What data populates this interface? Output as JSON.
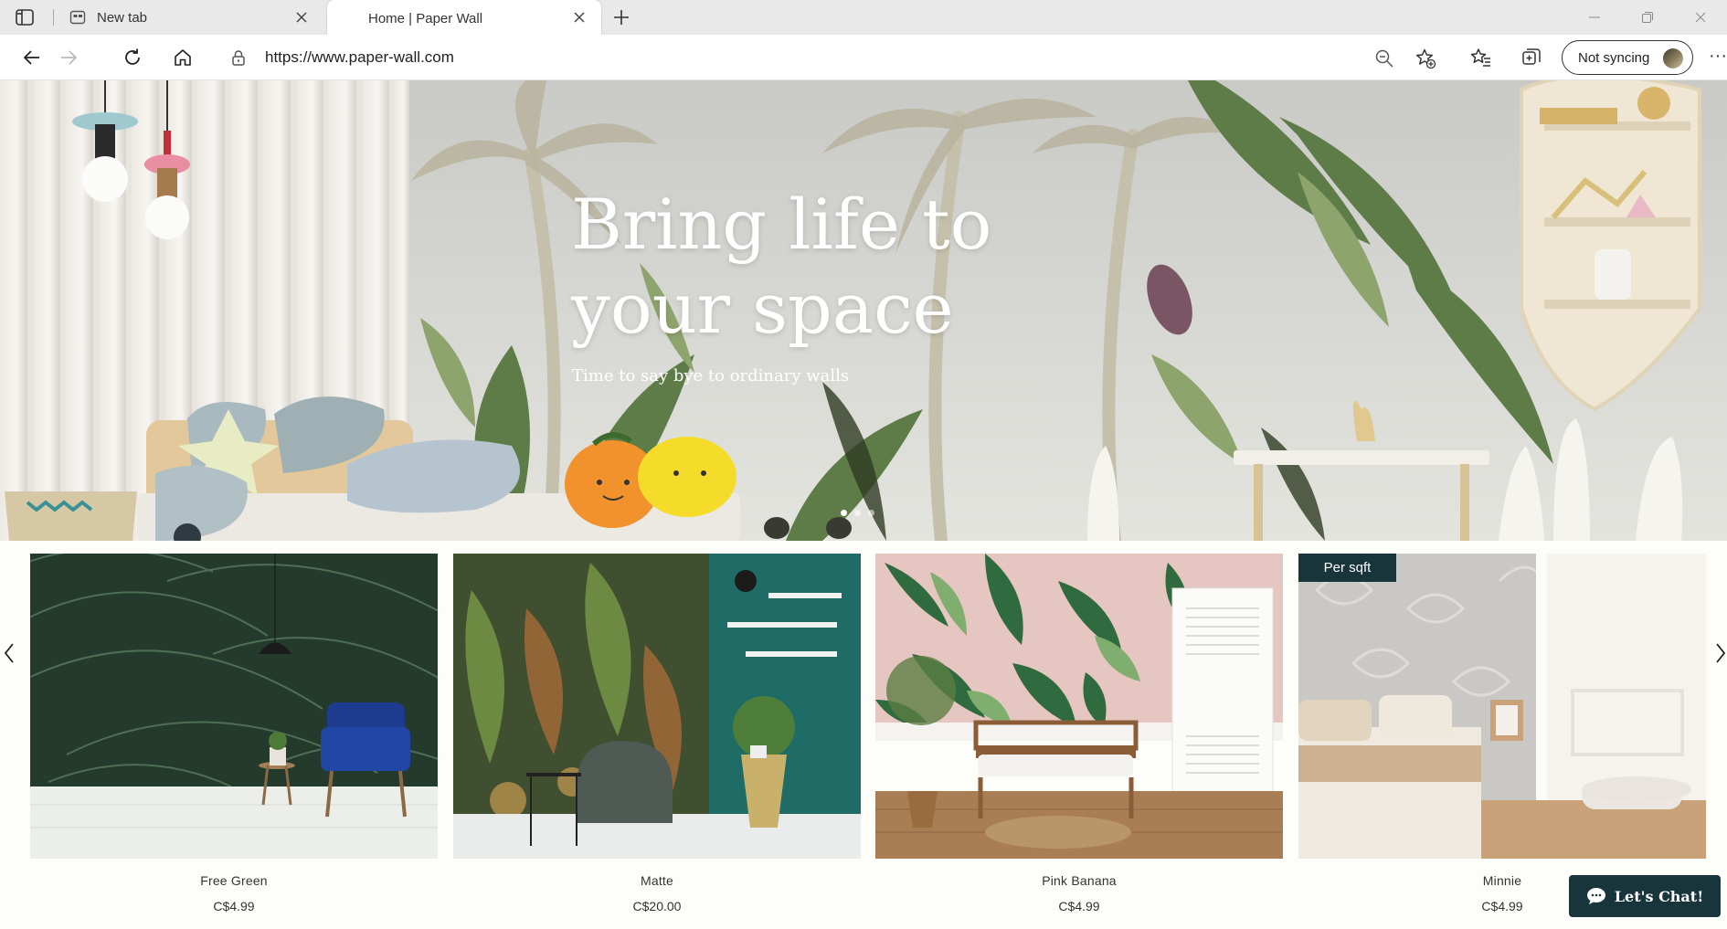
{
  "browser": {
    "tabs": [
      {
        "title": "New tab",
        "active": false
      },
      {
        "title": "Home | Paper Wall",
        "active": true
      }
    ],
    "url": "https://www.paper-wall.com",
    "sync_label": "Not syncing",
    "more_label": "···"
  },
  "hero": {
    "title": "Bring life to your space",
    "subtitle": "Time to say bye to ordinary walls",
    "slides_total": 3,
    "active_slide": 1
  },
  "products": [
    {
      "name": "Free Green",
      "price": "C$4.99",
      "badge": ""
    },
    {
      "name": "Matte",
      "price": "C$20.00",
      "badge": ""
    },
    {
      "name": "Pink Banana",
      "price": "C$4.99",
      "badge": ""
    },
    {
      "name": "Minnie",
      "price": "C$4.99",
      "badge": "Per sqft"
    }
  ],
  "chat": {
    "label": "Let's Chat!"
  },
  "icons": {
    "back": "arrow-left-icon",
    "forward": "arrow-right-icon",
    "refresh": "refresh-icon",
    "home": "home-icon",
    "lock": "lock-icon",
    "zoom": "zoom-out-icon",
    "favorite": "star-add-icon",
    "favorites": "favorites-list-icon",
    "collections": "collections-icon",
    "chat": "chat-bubble-icon"
  },
  "colors": {
    "accent": "#17353a",
    "page_bg": "#fdfdf9"
  }
}
